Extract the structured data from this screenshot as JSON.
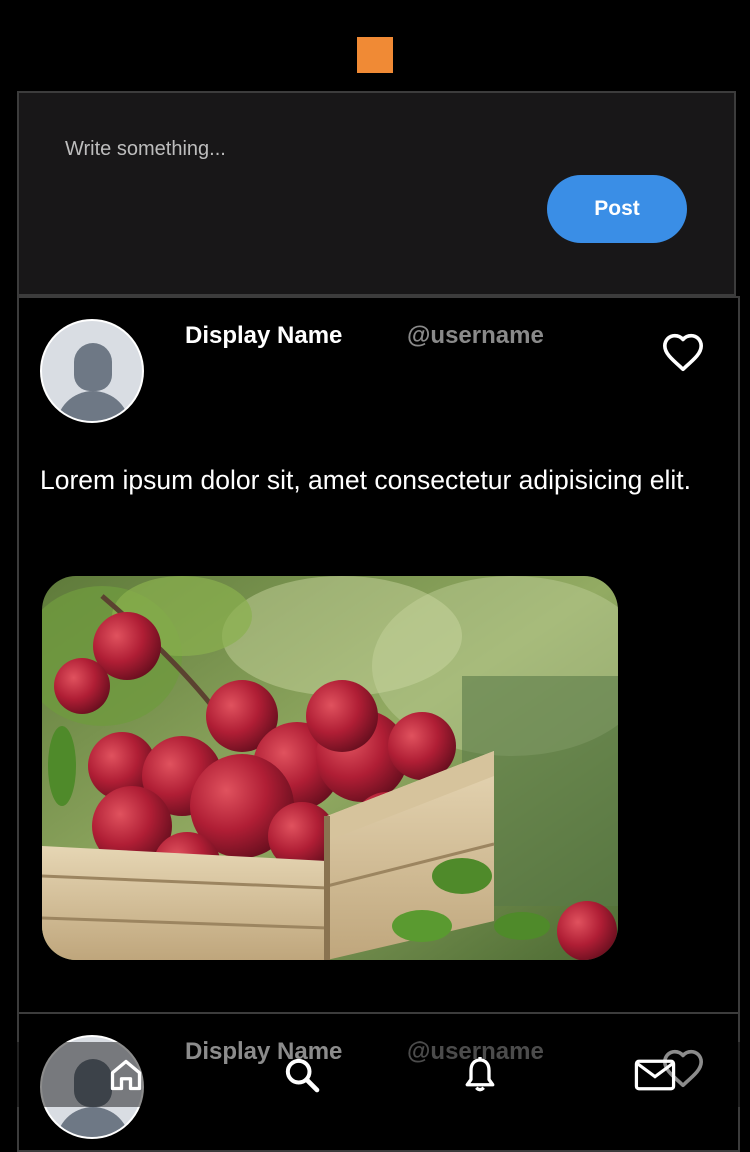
{
  "composer": {
    "placeholder": "Write something...",
    "post_label": "Post"
  },
  "posts": [
    {
      "display_name": "Display Name",
      "username": "@username",
      "text": "Lorem ipsum dolor sit, amet consectetur adipisicing elit.",
      "image_icon": "photo-apples-in-wooden-crate",
      "liked": false
    },
    {
      "display_name": "Display Name",
      "username": "@username",
      "liked": false
    }
  ],
  "nav": {
    "items": [
      "home-icon",
      "search-icon",
      "bell-icon",
      "mail-icon"
    ]
  },
  "colors": {
    "accent": "#3A8EE6",
    "logo": "#F08A35",
    "background": "#000000",
    "composer_bg": "#181718",
    "border": "#3c3c3c",
    "username": "#8a8a8a"
  }
}
